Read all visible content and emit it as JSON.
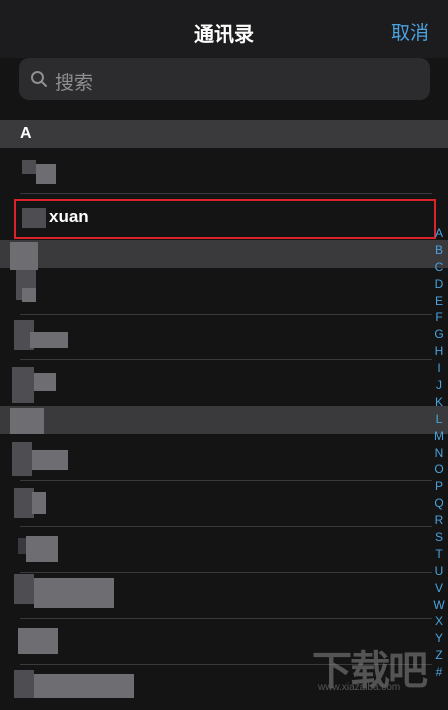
{
  "header": {
    "title": "通讯录",
    "cancel_label": "取消"
  },
  "search": {
    "placeholder": "搜索",
    "icon": "search-icon"
  },
  "sections": [
    {
      "letter": "A"
    }
  ],
  "highlighted_contact": {
    "name_visible": "xuan"
  },
  "index_letters": [
    "A",
    "B",
    "C",
    "D",
    "E",
    "F",
    "G",
    "H",
    "I",
    "J",
    "K",
    "L",
    "M",
    "N",
    "O",
    "P",
    "Q",
    "R",
    "S",
    "T",
    "U",
    "V",
    "W",
    "X",
    "Y",
    "Z",
    "#"
  ],
  "watermark": {
    "main": "下载吧",
    "sub": "www.xiazaiba.com"
  },
  "colors": {
    "accent": "#4aa3df",
    "highlight_border": "#d9242b",
    "background": "#141414",
    "section_bg": "#3a3a3c"
  }
}
